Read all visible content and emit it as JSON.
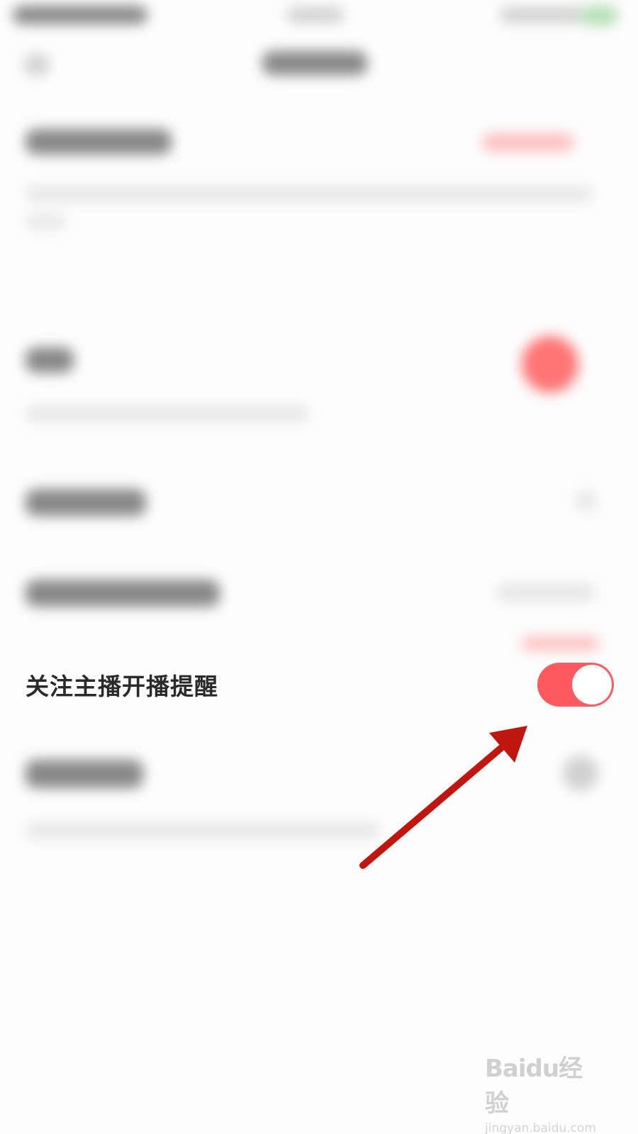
{
  "setting": {
    "label": "关注主播开播提醒",
    "enabled": true,
    "toggle_color": "#ff5a5f"
  },
  "annotation": {
    "arrow_color": "#c0160f"
  },
  "watermark": {
    "logo_text": "Baidu经验",
    "url_text": "jingyan.baidu.com"
  }
}
